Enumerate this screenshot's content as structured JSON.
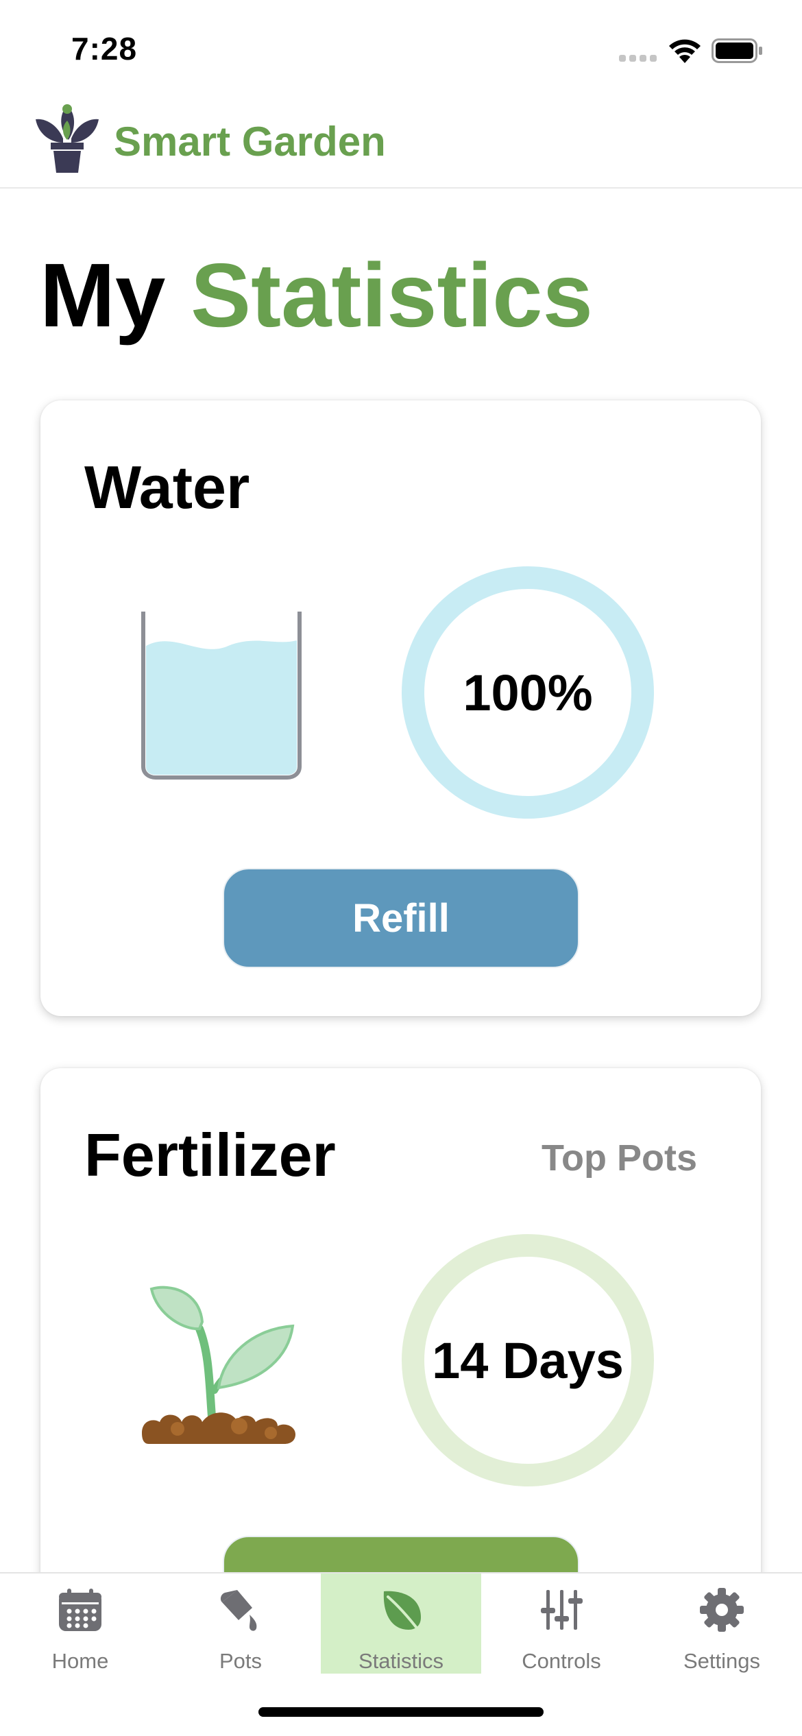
{
  "status_bar": {
    "time": "7:28",
    "icons": [
      "signal-icon",
      "wifi-icon",
      "battery-icon"
    ]
  },
  "header": {
    "app_name": "Smart Garden",
    "logo_icon": "plant-pot-logo-icon"
  },
  "page_title": {
    "first": "My",
    "accent": "Statistics"
  },
  "water_card": {
    "title": "Water",
    "ring_value": "100%",
    "level_fraction": 1.0,
    "button_label": "Refill",
    "icon": "water-glass-icon"
  },
  "fertilizer_card": {
    "title": "Fertilizer",
    "link": "Top Pots",
    "ring_value": "14 Days",
    "icon": "sprout-icon"
  },
  "tab_bar": {
    "tabs": [
      {
        "label": "Home",
        "icon": "calendar-icon",
        "active": false
      },
      {
        "label": "Pots",
        "icon": "watering-can-icon",
        "active": false
      },
      {
        "label": "Statistics",
        "icon": "leaf-icon",
        "active": true
      },
      {
        "label": "Controls",
        "icon": "sliders-icon",
        "active": false
      },
      {
        "label": "Settings",
        "icon": "gear-icon",
        "active": false
      }
    ]
  },
  "colors": {
    "accent_green": "#69a04f",
    "water_ring": "#c8ecf4",
    "fertilizer_ring": "#e2efd6",
    "refill_button": "#5e98bc",
    "active_tab": "#d4efc7"
  }
}
